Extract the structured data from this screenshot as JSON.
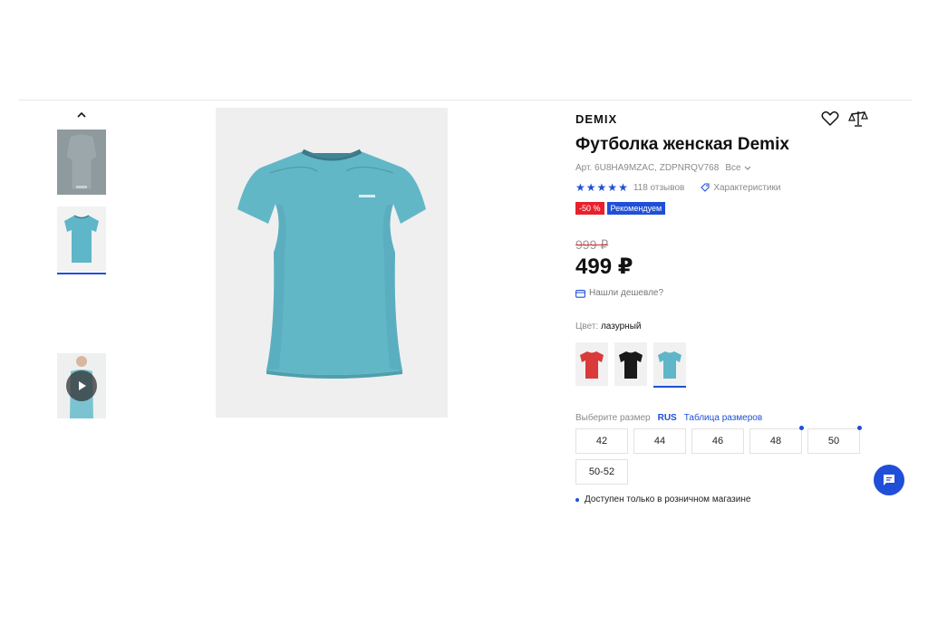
{
  "product": {
    "brand": "DEMIX",
    "title": "Футболка женская Demix",
    "sku_label": "Арт. 6U8HA9MZAC, ZDPNRQV768",
    "sku_all": "Все",
    "rating": 5,
    "reviews": "118 отзывов",
    "specs": "Характеристики",
    "badges": [
      "-50 %",
      "Рекомендуем"
    ],
    "old_price": "999 ₽",
    "price": "499 ₽",
    "cheaper": "Нашли дешевле?",
    "color_label": "Цвет:",
    "color_value": "лазурный",
    "size_label": "Выберите размер",
    "size_system": "RUS",
    "size_table": "Таблица размеров",
    "sizes": [
      "42",
      "44",
      "46",
      "48",
      "50",
      "50-52"
    ],
    "notice": "Доступен только в розничном магазине"
  },
  "colors": {
    "accent": "#1f4fd8",
    "sale": "#e8202b",
    "shirt_azure": "#5fb6c8",
    "shirt_red": "#d93a3a",
    "shirt_black": "#1a1a1a"
  },
  "icons": {
    "up": "chevron-up-icon",
    "play": "play-icon",
    "favorite": "heart-icon",
    "compare": "scales-icon",
    "tag": "tag-icon",
    "wallet": "wallet-icon",
    "chat": "chat-icon"
  }
}
